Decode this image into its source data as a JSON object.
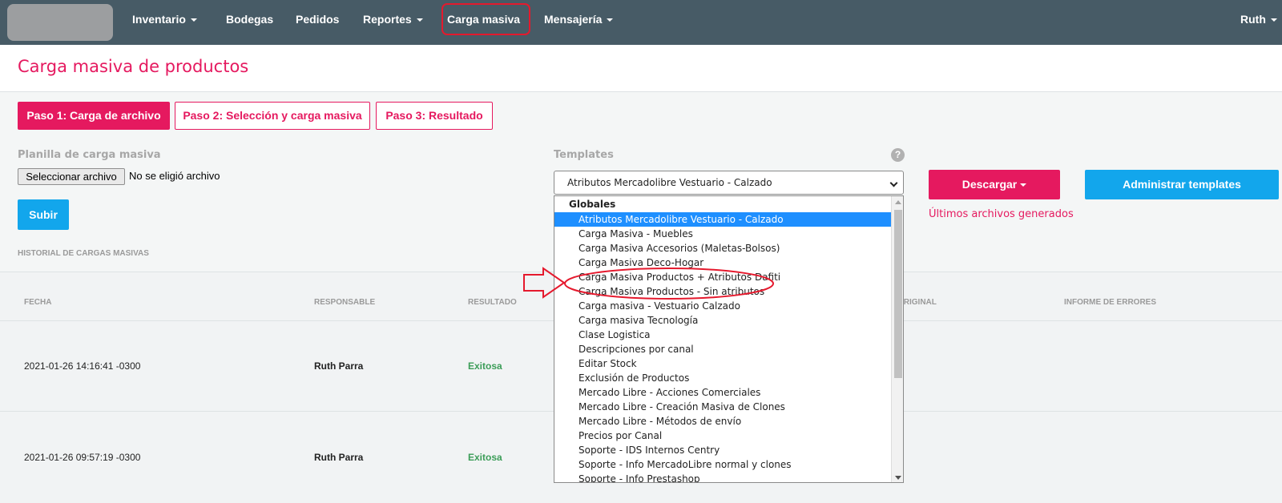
{
  "nav": {
    "items": [
      {
        "label": "Inventario",
        "has_caret": true
      },
      {
        "label": "Bodegas",
        "has_caret": false
      },
      {
        "label": "Pedidos",
        "has_caret": false
      },
      {
        "label": "Reportes",
        "has_caret": true
      },
      {
        "label": "Carga masiva",
        "has_caret": false
      },
      {
        "label": "Mensajería",
        "has_caret": true
      }
    ],
    "user": "Ruth"
  },
  "page": {
    "title": "Carga masiva de productos"
  },
  "steps": [
    {
      "label": "Paso 1: Carga de archivo",
      "active": true
    },
    {
      "label": "Paso 2: Selección y carga masiva",
      "active": false
    },
    {
      "label": "Paso 3: Resultado",
      "active": false
    }
  ],
  "upload": {
    "label": "Planilla de carga masiva",
    "file_button": "Seleccionar archivo",
    "file_status": "No se eligió archivo",
    "submit": "Subir",
    "history_label": "HISTORIAL DE CARGAS MASIVAS"
  },
  "templates": {
    "label": "Templates",
    "help_icon": "?",
    "selected": "Atributos Mercadolibre Vestuario - Calzado",
    "group": "Globales",
    "options": [
      "Atributos Mercadolibre Vestuario - Calzado",
      "Carga Masiva - Muebles",
      "Carga Masiva Accesorios (Maletas-Bolsos)",
      "Carga Masiva Deco-Hogar",
      "Carga Masiva Productos + Atributos Dafiti",
      "Carga Masiva Productos - Sin atributos",
      "Carga masiva - Vestuario Calzado",
      "Carga masiva Tecnología",
      "Clase Logistica",
      "Descripciones por canal",
      "Editar Stock",
      "Exclusión de Productos",
      "Mercado Libre - Acciones Comerciales",
      "Mercado Libre - Creación Masiva de Clones",
      "Mercado Libre - Métodos de envío",
      "Precios por Canal",
      "Soporte - IDS Internos Centry",
      "Soporte - Info MercadoLibre normal y clones",
      "Soporte - Info Prestashop"
    ]
  },
  "actions": {
    "download": "Descargar",
    "manage": "Administrar templates",
    "recent": "Últimos archivos generados"
  },
  "table": {
    "headers": [
      "FECHA",
      "RESPONSABLE",
      "RESULTADO",
      "ORIGINAL",
      "INFORME DE ERRORES"
    ],
    "rows": [
      {
        "fecha": "2021-01-26 14:16:41 -0300",
        "responsable": "Ruth Parra",
        "resultado": "Exitosa"
      },
      {
        "fecha": "2021-01-26 09:57:19 -0300",
        "responsable": "Ruth Parra",
        "resultado": "Exitosa"
      }
    ]
  },
  "colors": {
    "accent": "#e5195f",
    "primary": "#12a6ec",
    "nav_bg": "#475b66",
    "success": "#3c9d58",
    "highlight": "#e5192d"
  }
}
